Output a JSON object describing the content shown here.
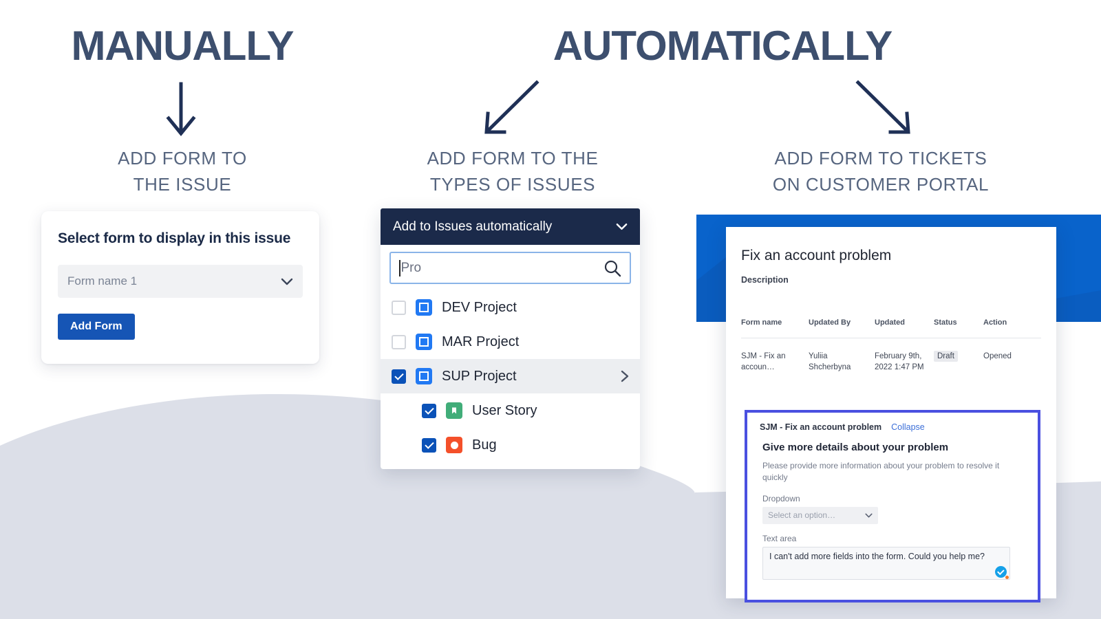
{
  "colors": {
    "headline": "#3d4f6e",
    "subhead": "#56657f",
    "primary_blue": "#1655b5",
    "navy_header": "#1b2a4a",
    "portal_banner_blue": "#0963cb",
    "embedded_form_border": "#4a50e0",
    "wave_gray": "#dcdfe8",
    "checkbox_checked": "#0b52b8",
    "project_icon": "#2179f3",
    "story_icon": "#41ad79",
    "bug_icon": "#f4502a"
  },
  "columns": {
    "manual": {
      "headline": "MANUALLY",
      "subhead_line1": "ADD FORM TO",
      "subhead_line2": "THE ISSUE",
      "arrow_icon": "arrow-down-icon"
    },
    "automatic": {
      "headline": "AUTOMATICALLY",
      "arrow_left_icon": "arrow-down-left-icon",
      "arrow_right_icon": "arrow-down-right-icon",
      "subhead_issue_types_line1": "ADD FORM TO THE",
      "subhead_issue_types_line2": "TYPES OF ISSUES",
      "subhead_portal_line1": "ADD FORM TO TICKETS",
      "subhead_portal_line2": "ON CUSTOMER PORTAL"
    }
  },
  "manual_card": {
    "title": "Select form to display in this issue",
    "select_value": "Form name 1",
    "select_chevron": "chevron-down-icon",
    "button_label": "Add Form"
  },
  "auto_panel": {
    "header_label": "Add to Issues automatically",
    "header_chevron": "chevron-down-icon",
    "search": {
      "value": "Pro",
      "placeholder": "Pro",
      "icon": "search-icon"
    },
    "options": [
      {
        "label": "DEV Project",
        "checked": false,
        "icon": "project-icon",
        "level": 0,
        "expand": false,
        "highlighted": false
      },
      {
        "label": "MAR Project",
        "checked": false,
        "icon": "project-icon",
        "level": 0,
        "expand": false,
        "highlighted": false
      },
      {
        "label": "SUP Project",
        "checked": true,
        "icon": "project-icon",
        "level": 0,
        "expand": true,
        "highlighted": true
      },
      {
        "label": "User Story",
        "checked": true,
        "icon": "user-story-icon",
        "level": 1,
        "expand": false,
        "highlighted": false
      },
      {
        "label": "Bug",
        "checked": true,
        "icon": "bug-icon",
        "level": 1,
        "expand": false,
        "highlighted": false
      }
    ],
    "expand_chevron": "chevron-right-icon"
  },
  "portal": {
    "title": "Fix an account problem",
    "description_label": "Description",
    "table": {
      "headers": [
        "Form name",
        "Updated By",
        "Updated",
        "Status",
        "Action"
      ],
      "rows": [
        {
          "form_name": "SJM - Fix an accoun…",
          "updated_by": "Yuliia Shcherbyna",
          "updated": "February 9th, 2022 1:47 PM",
          "status": "Draft",
          "action": "Opened"
        }
      ]
    },
    "embedded_form": {
      "form_name": "SJM - Fix an account problem",
      "collapse_label": "Collapse",
      "heading": "Give more details about your problem",
      "paragraph": "Please provide more information about your problem to resolve it quickly",
      "dropdown_label": "Dropdown",
      "dropdown_placeholder": "Select an option…",
      "dropdown_chevron": "chevron-down-icon",
      "textarea_label": "Text area",
      "textarea_value": "I can't add more fields into the form. Could you help me?",
      "assistant_badge": "grammarly-check-icon"
    }
  }
}
